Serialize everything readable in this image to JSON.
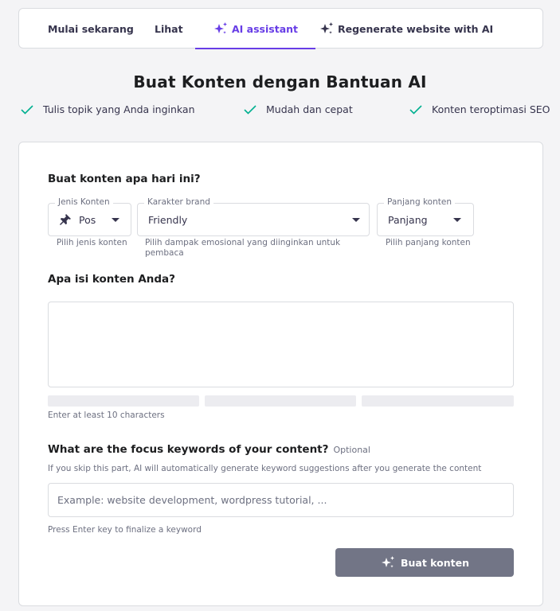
{
  "tabs": [
    {
      "label": "Mulai sekarang",
      "active": false
    },
    {
      "label": "Lihat",
      "active": false
    },
    {
      "label": "AI assistant",
      "active": true,
      "icon": "sparkle-icon"
    },
    {
      "label": "Regenerate website with AI",
      "active": false,
      "icon": "sparkle-icon"
    }
  ],
  "heading": "Buat Konten dengan Bantuan AI",
  "features": [
    "Tulis topik yang Anda inginkan",
    "Mudah dan cepat",
    "Konten teroptimasi SEO"
  ],
  "form": {
    "section1_title": "Buat konten apa hari ini?",
    "content_type": {
      "label": "Jenis Konten",
      "value": "Pos",
      "icon": "pin-icon",
      "hint": "Pilih jenis konten"
    },
    "brand_character": {
      "label": "Karakter brand",
      "value": "Friendly",
      "hint": "Pilih dampak emosional yang diinginkan untuk pembaca"
    },
    "content_length": {
      "label": "Panjang konten",
      "value": "Panjang",
      "hint": "Pilih panjang konten"
    },
    "section2_title": "Apa isi konten Anda?",
    "content_value": "",
    "content_hint": "Enter at least 10 characters",
    "keywords_title": "What are the focus keywords of your content?",
    "keywords_optional": "Optional",
    "keywords_description": "If you skip this part, AI will automatically generate keyword suggestions after you generate the content",
    "keywords_placeholder": "Example: website development, wordpress tutorial, ...",
    "keywords_value": "",
    "keywords_hint": "Press Enter key to finalize a keyword",
    "submit_label": "Buat konten"
  },
  "colors": {
    "accent": "#673de6",
    "check": "#00b090",
    "button_disabled": "#727586"
  }
}
